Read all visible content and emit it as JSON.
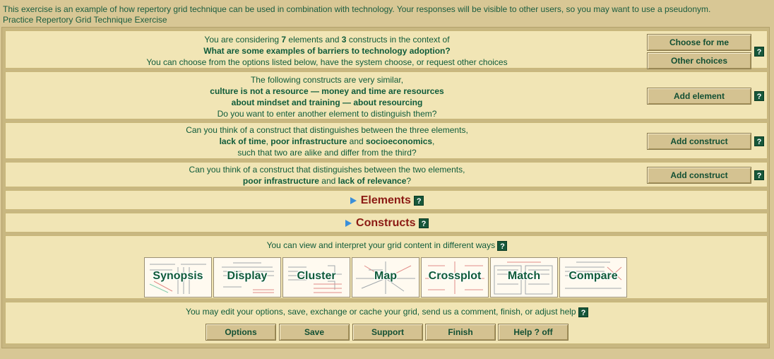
{
  "intro": {
    "line1": "This exercise is an example of how repertory grid technique can be used in combination with technology. Your responses will be visible to other users, so you may want to use a pseudonym.",
    "line2": "Practice Repertory Grid Technique Exercise"
  },
  "help_label": "?",
  "p1": {
    "pre": "You are considering ",
    "n_elements": "7",
    "mid": " elements and ",
    "n_constructs": "3",
    "post": " constructs in the context of",
    "question": "What are some examples of barriers to technology adoption?",
    "line3": "You can choose from the options listed below, have the system choose, or request other choices",
    "choose_btn": "Choose for me",
    "other_btn": "Other choices"
  },
  "p2": {
    "line1": "The following constructs are very similar,",
    "line2": "culture is not a resource — money and time are resources",
    "line3": "about mindset and training — about resourcing",
    "line4": "Do you want to enter another element to distinguish them?",
    "button": "Add element"
  },
  "p3": {
    "line1": "Can you think of a construct that distinguishes between the three elements,",
    "e1": "lack of time",
    "sep1": ", ",
    "e2": "poor infrastructure",
    "and": " and ",
    "e3": "socioeconomics",
    "end": ",",
    "line3": "such that two are alike and differ from the third?",
    "button": "Add construct"
  },
  "p4": {
    "line1": "Can you think of a construct that distinguishes between the two elements,",
    "e1": "poor infrastructure",
    "and": " and ",
    "e2": "lack of relevance",
    "end": "?",
    "button": "Add construct"
  },
  "elements_toggle": "Elements",
  "constructs_toggle": "Constructs",
  "views": {
    "intro": "You can view and interpret your grid content in different ways",
    "items": [
      "Synopsis",
      "Display",
      "Cluster",
      "Map",
      "Crossplot",
      "Match",
      "Compare"
    ]
  },
  "footer": {
    "text": "You may edit your options, save, exchange or cache your grid, send us a comment, finish, or adjust help",
    "buttons": [
      "Options",
      "Save",
      "Support",
      "Finish",
      "Help ? off"
    ]
  }
}
